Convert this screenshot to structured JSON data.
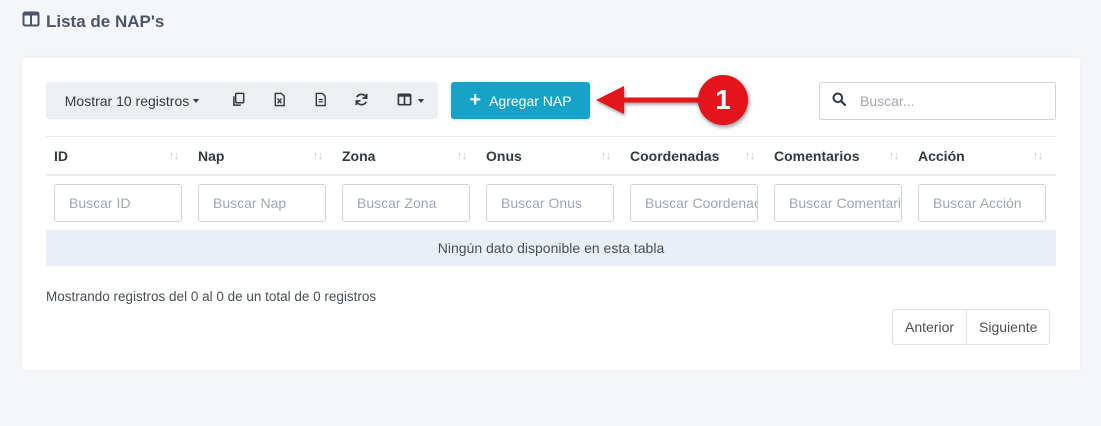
{
  "page": {
    "title": "Lista de NAP's"
  },
  "toolbar": {
    "show_label": "Mostrar 10 registros",
    "copy_icon": "copy-icon",
    "excel_icon": "file-excel-icon",
    "csv_icon": "file-text-icon",
    "refresh_icon": "refresh-icon",
    "columns_icon": "columns-icon"
  },
  "add_button": {
    "label": "Agregar NAP",
    "color": "#17a2c8"
  },
  "annotation": {
    "number": "1",
    "color": "#e3141b"
  },
  "search": {
    "placeholder": "Buscar..."
  },
  "table": {
    "columns": [
      "ID",
      "Nap",
      "Zona",
      "Onus",
      "Coordenadas",
      "Comentarios",
      "Acción"
    ],
    "filters": [
      "Buscar ID",
      "Buscar Nap",
      "Buscar Zona",
      "Buscar Onus",
      "Buscar Coordenadas",
      "Buscar Comentarios",
      "Buscar Acción"
    ],
    "empty_message": "Ningún dato disponible en esta tabla"
  },
  "info": {
    "text": "Mostrando registros del 0 al 0 de un total de 0 registros"
  },
  "pagination": {
    "prev": "Anterior",
    "next": "Siguiente"
  }
}
